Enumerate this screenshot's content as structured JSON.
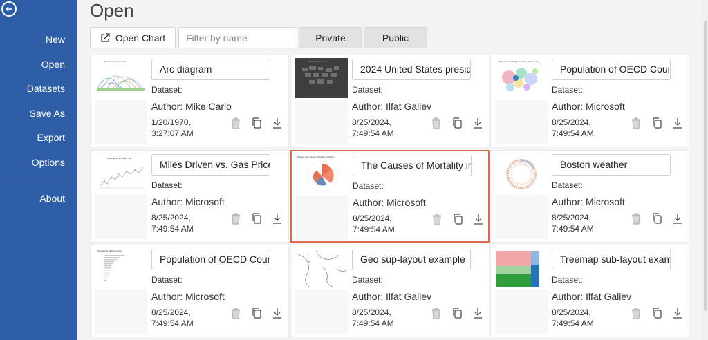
{
  "sidebar": {
    "items": [
      {
        "label": "New"
      },
      {
        "label": "Open"
      },
      {
        "label": "Datasets"
      },
      {
        "label": "Save As"
      },
      {
        "label": "Export"
      },
      {
        "label": "Options"
      },
      {
        "label": "About"
      }
    ]
  },
  "main": {
    "title": "Open",
    "toolbar": {
      "open_chart_label": "Open Chart",
      "filter_placeholder": "Filter by name",
      "private_label": "Private",
      "public_label": "Public"
    },
    "dataset_label": "Dataset:",
    "cards": [
      {
        "title": "Arc diagram",
        "author": "Author: Mike Carlo",
        "date": "1/20/1970, 3:27:07 AM",
        "thumb": "arc"
      },
      {
        "title": "2024 United States presid",
        "author": "Author: Ilfat Galiev",
        "date": "8/25/2024, 7:49:54 AM",
        "thumb": "dark-map"
      },
      {
        "title": "Population of OECD Coun",
        "author": "Author: Microsoft",
        "date": "8/25/2024, 7:49:54 AM",
        "thumb": "bubbles"
      },
      {
        "title": "Miles Driven vs. Gas Price:",
        "author": "Author: Microsoft",
        "date": "8/25/2024, 7:49:54 AM",
        "thumb": "line"
      },
      {
        "title": "The Causes of Mortality ir",
        "author": "Author: Microsoft",
        "date": "8/25/2024, 7:49:54 AM",
        "thumb": "radial"
      },
      {
        "title": "Boston weather",
        "author": "Author: Microsoft",
        "date": "8/25/2024, 7:49:54 AM",
        "thumb": "ring"
      },
      {
        "title": "Population of OECD Coun",
        "author": "Author: Microsoft",
        "date": "8/25/2024, 7:49:54 AM",
        "thumb": "hbar"
      },
      {
        "title": "Geo sup-layout example",
        "author": "Author: Ilfat Galiev",
        "date": "8/25/2024, 7:49:54 AM",
        "thumb": "geo"
      },
      {
        "title": "Treemap sub-layout exam",
        "author": "Author: Ilfat Galiev",
        "date": "8/25/2024, 7:49:54 AM",
        "thumb": "treemap"
      }
    ]
  },
  "colors": {
    "sidebar_bg": "#2f5ea8",
    "selected_border": "#e06a4e"
  }
}
